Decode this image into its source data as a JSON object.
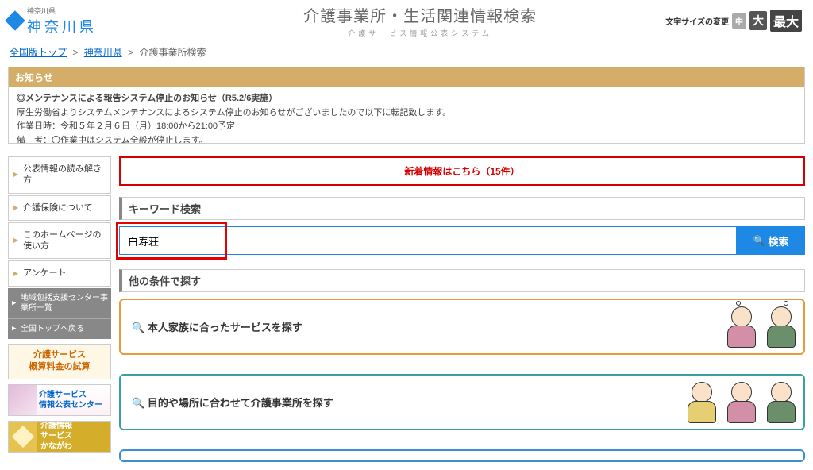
{
  "header": {
    "small_org": "神奈川県",
    "org_name": "神奈川県",
    "title_main": "介護事業所・生活関連情報検索",
    "title_sub": "介護サービス情報公表システム",
    "fontsize_label": "文字サイズの変更",
    "fs_mid": "中",
    "fs_large": "大",
    "fs_xlarge": "最大"
  },
  "breadcrumb": {
    "top": "全国版トップ",
    "ken": "神奈川県",
    "current": "介護事業所検索",
    "sep": ">"
  },
  "notice": {
    "head": "お知らせ",
    "line1": "◎メンテナンスによる報告システム停止のお知らせ（R5.2/6実施）",
    "line2": "厚生労働省よりシステムメンテナンスによるシステム停止のお知らせがございましたので以下に転記致します。",
    "line3": "作業日時：令和５年２月６日（月）18:00から21:00予定",
    "line4": "備　考：〇作業中はシステム全般が停止します。"
  },
  "nav": {
    "items": [
      "公表情報の読み解き方",
      "介護保険について",
      "このホームページの使い方",
      "アンケート"
    ],
    "sub_items": [
      "地域包括支援センター事業所一覧",
      "全国トップへ戻る"
    ],
    "banner_fee": "介護サービス\n概算料金の試算",
    "banner_center": "介護サービス\n情報公表センター",
    "banner_kanagawa": "介護情報\nサービス\nかながわ"
  },
  "right": {
    "new_info": "新着情報はこちら（15件）",
    "kw_head": "キーワード検索",
    "kw_value": "白寿荘",
    "kw_placeholder": "",
    "search_btn": "検索",
    "cond_head": "他の条件で探す",
    "cond1": "本人家族に合ったサービスを探す",
    "cond2": "目的や場所に合わせて介護事業所を探す"
  }
}
